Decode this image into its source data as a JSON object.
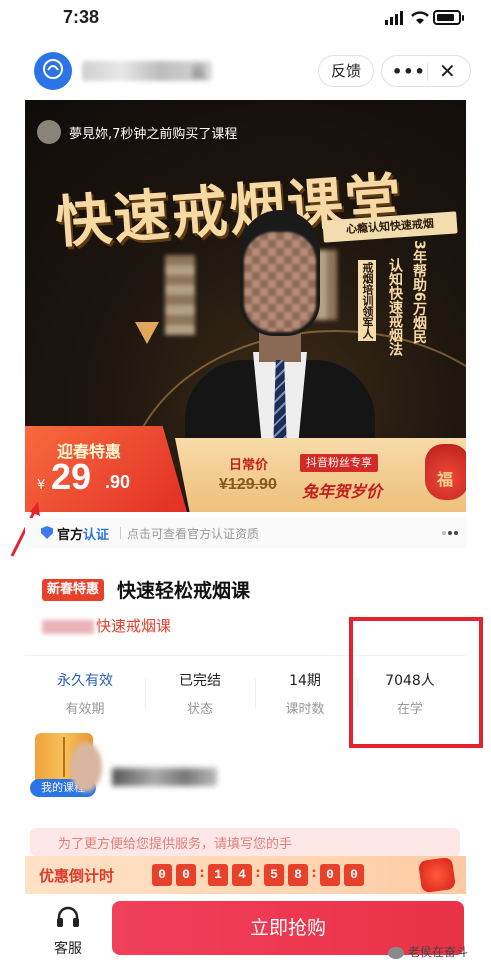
{
  "status_bar": {
    "time": "7:38"
  },
  "header": {
    "shop_name_suffix": "云",
    "feedback_label": "反馈",
    "more_icon": "more-dots-icon",
    "close_icon": "close-icon"
  },
  "banner": {
    "buyer_text": "夢見妳,7秒钟之前购买了课程",
    "title": "快速戒烟课堂",
    "ribbon": "心瘾认知快速戒烟",
    "vertical1": "戒烟培训领军人",
    "vertical2": "认知快速戒烟法",
    "vertical3": "3年帮助6万烟民",
    "promo_tag": "迎春特惠",
    "currency": "¥",
    "price_int": "29",
    "price_dec": ".90",
    "regular_label": "日常价",
    "regular_price": "¥129.90",
    "fans_tag": "抖音粉丝专享",
    "promo_text": "兔年贺岁价",
    "bag_text": "福"
  },
  "cert": {
    "brand_prefix": "官方",
    "brand_highlight": "认证",
    "tip": "点击可查看官方认证资质"
  },
  "product": {
    "tag": "新春特惠",
    "name": "快速轻松戒烟课",
    "subtitle": "快速戒烟课"
  },
  "stats": [
    {
      "value": "永久有效",
      "label": "有效期"
    },
    {
      "value": "已完结",
      "label": "状态"
    },
    {
      "value": "14期",
      "label": "课时数"
    },
    {
      "value": "7048人",
      "label": "在学"
    }
  ],
  "my_course": {
    "label": "我的课程"
  },
  "notice": {
    "text": "为了更方便给您提供服务，请填写您的手"
  },
  "countdown": {
    "label": "优惠倒计时",
    "digits": [
      "0",
      "0",
      "1",
      "4",
      "5",
      "8",
      "0",
      "0"
    ]
  },
  "bottom": {
    "service_label": "客服",
    "buy_label": "立即抢购",
    "watermark": "老侯在奋斗"
  },
  "colors": {
    "accent_red": "#e8412b",
    "buy_button": "#ea3146",
    "brand_blue": "#2c73e8"
  }
}
